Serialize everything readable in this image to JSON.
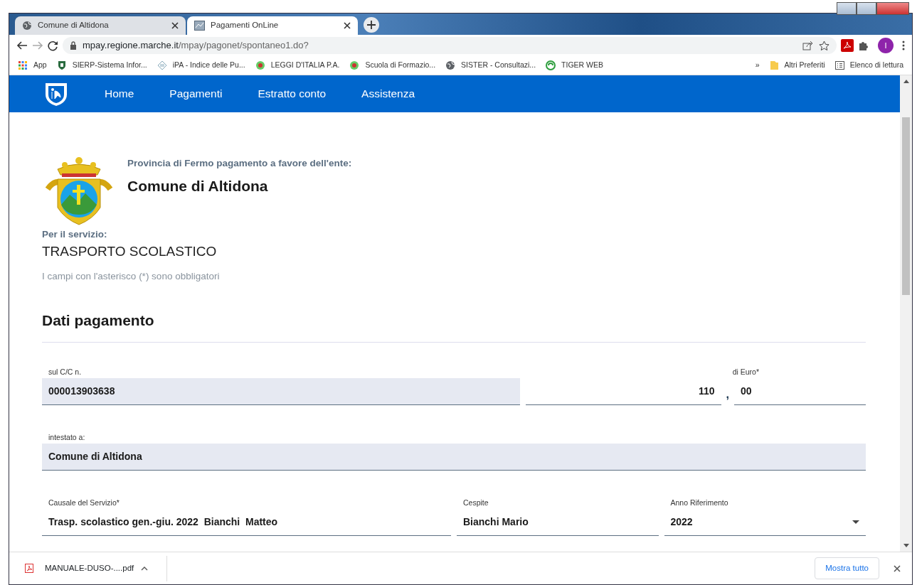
{
  "browser": {
    "tabs": [
      {
        "title": "Comune di Altidona",
        "selected": false
      },
      {
        "title": "Pagamenti OnLine",
        "selected": true
      }
    ],
    "url_host": "mpay.regione.marche.it",
    "url_path": "/mpay/pagonet/spontaneo1.do?",
    "profile_initial": "I",
    "bookmarks": [
      {
        "label": "App"
      },
      {
        "label": "SIERP-Sistema Infor..."
      },
      {
        "label": "iPA - Indice delle Pu..."
      },
      {
        "label": "LEGGI D'ITALIA P.A."
      },
      {
        "label": "Scuola di Formazio..."
      },
      {
        "label": "SISTER - Consultazi..."
      },
      {
        "label": "TIGER WEB"
      }
    ],
    "overflow": "»",
    "other_bookmarks": "Altri Preferiti",
    "reading_list": "Elenco di lettura"
  },
  "navbar": {
    "items": [
      "Home",
      "Pagamenti",
      "Estratto conto",
      "Assistenza"
    ]
  },
  "entity": {
    "caption": "Provincia di Fermo pagamento a favore dell'ente:",
    "name": "Comune di Altidona"
  },
  "service": {
    "label": "Per il servizio:",
    "name": "TRASPORTO SCOLASTICO"
  },
  "required_note": "I campi con l'asterisco (*) sono obbligatori",
  "section_title": "Dati pagamento",
  "rows": [
    [
      {
        "kind": "readonly",
        "label": "sul C/C n.",
        "value": "000013903638"
      },
      {
        "kind": "amount",
        "label": "di Euro*",
        "integer": "110",
        "separator": ",",
        "cents": "00"
      }
    ],
    [
      {
        "kind": "readonly",
        "label": "intestato a:",
        "value": "Comune di Altidona"
      }
    ],
    [
      {
        "kind": "text",
        "label": "Causale del Servizio*",
        "value": "Trasp. scolastico gen.-giu. 2022  Bianchi  Matteo"
      },
      {
        "kind": "text",
        "label": "Cespite",
        "value": "Bianchi Mario"
      },
      {
        "kind": "select",
        "label": "Anno Riferimento",
        "value": "2022"
      }
    ]
  ],
  "downloads": {
    "file": "MANUALE-DUSO-....pdf",
    "show_all": "Mostra tutto"
  }
}
